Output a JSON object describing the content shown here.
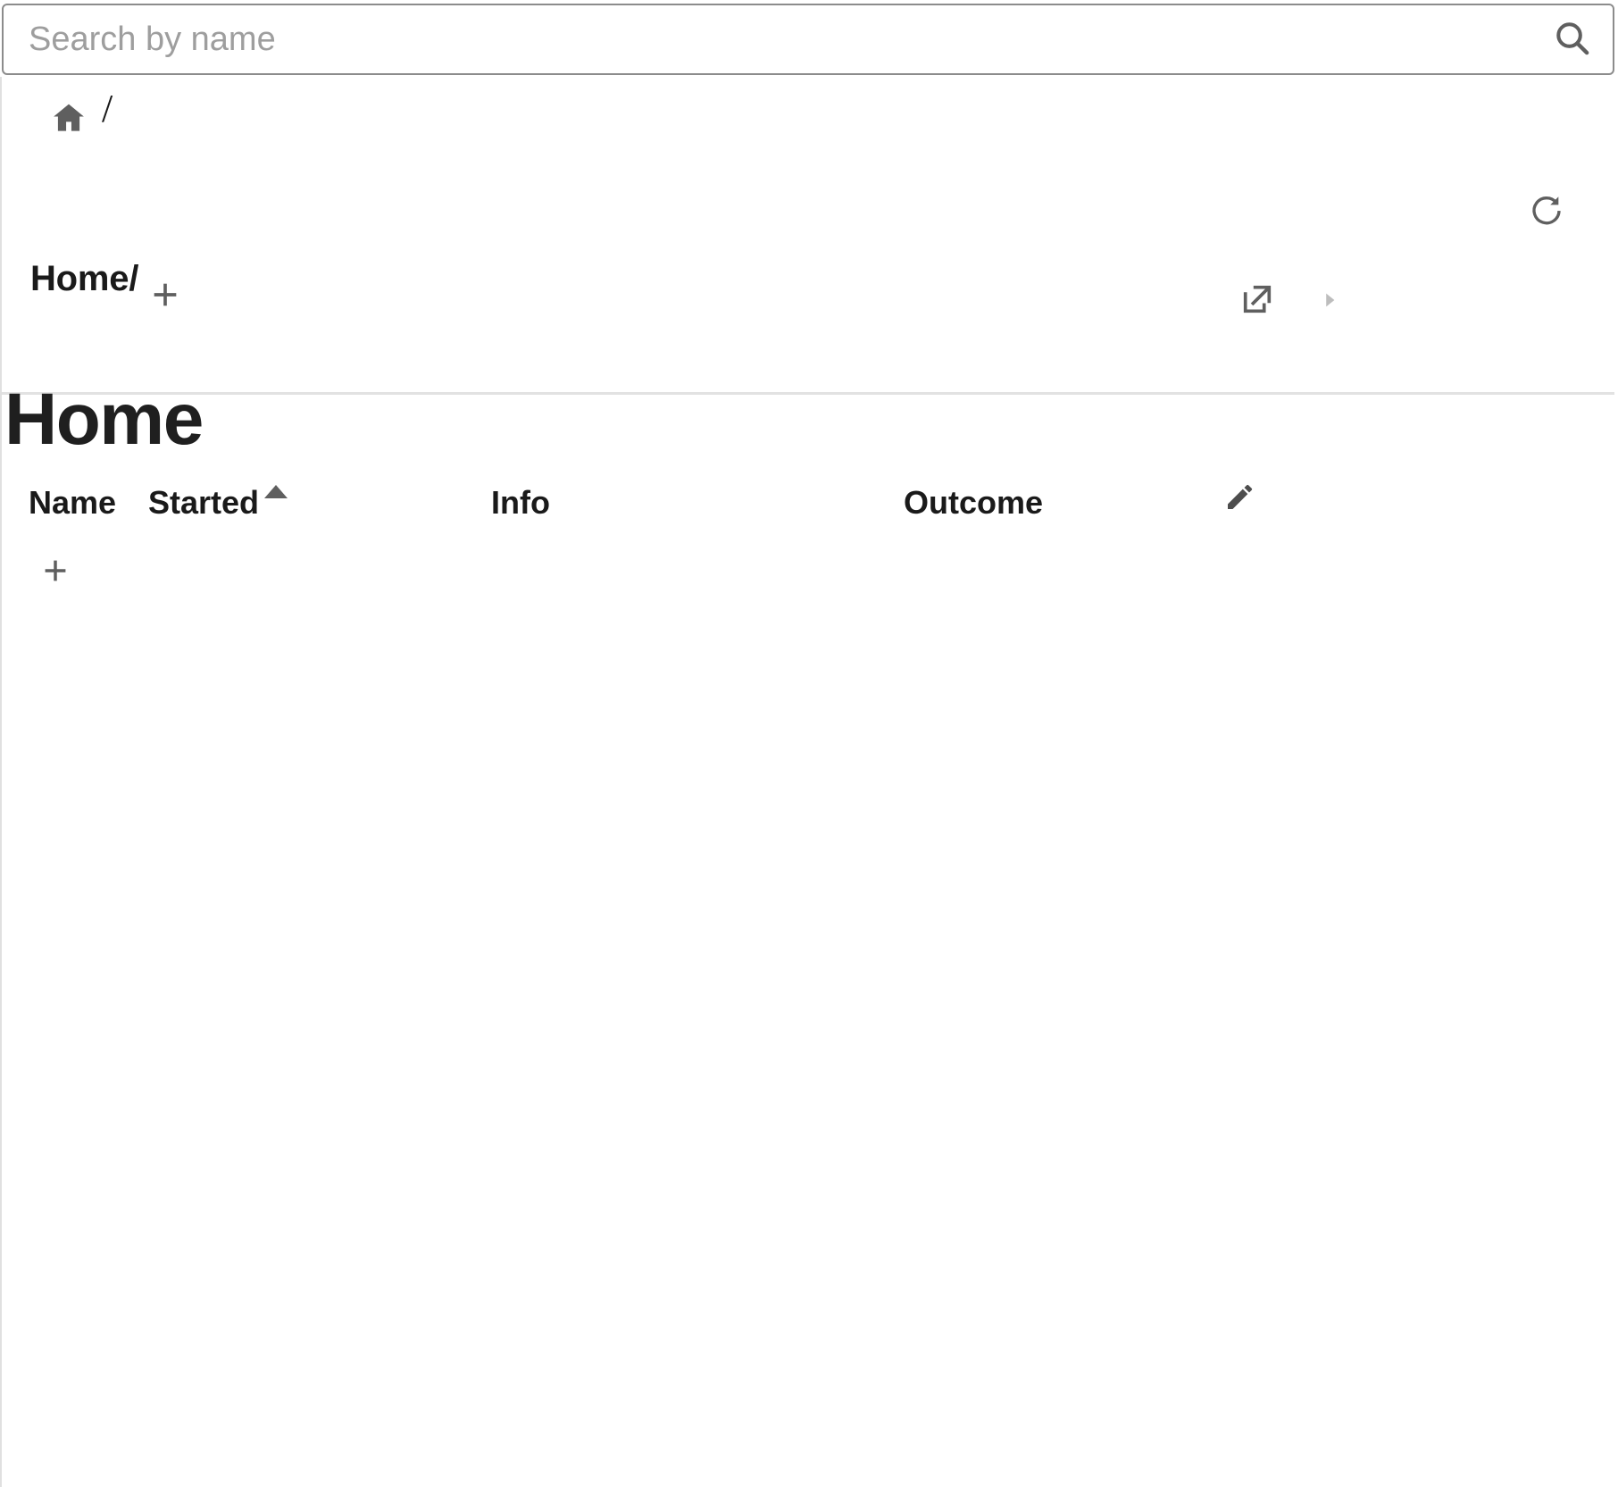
{
  "search": {
    "placeholder": "Search by name",
    "value": "",
    "icon": "search-icon"
  },
  "breadcrumb": {
    "home_icon": "home-icon",
    "separator_top": "/",
    "path_label": "Home/",
    "add_icon": "plus-icon",
    "refresh_icon": "refresh-icon",
    "launch_icon": "open-in-new-icon",
    "expand_icon": "triangle-right-icon"
  },
  "page": {
    "title": "Home"
  },
  "table": {
    "columns": [
      {
        "label": "Name",
        "sorted": false
      },
      {
        "label": "Started",
        "sorted": true,
        "sort_direction": "asc"
      },
      {
        "label": "Info",
        "sorted": false
      },
      {
        "label": "Outcome",
        "sorted": false
      }
    ],
    "edit_icon": "pencil-icon",
    "add_row_icon": "plus-icon",
    "rows": []
  },
  "colors": {
    "text": "#1a1a1a",
    "icon": "#5f5f5f",
    "muted": "#9e9e9e",
    "border": "#8c8c8c",
    "divider": "#e2e2e2",
    "background": "#ffffff"
  }
}
